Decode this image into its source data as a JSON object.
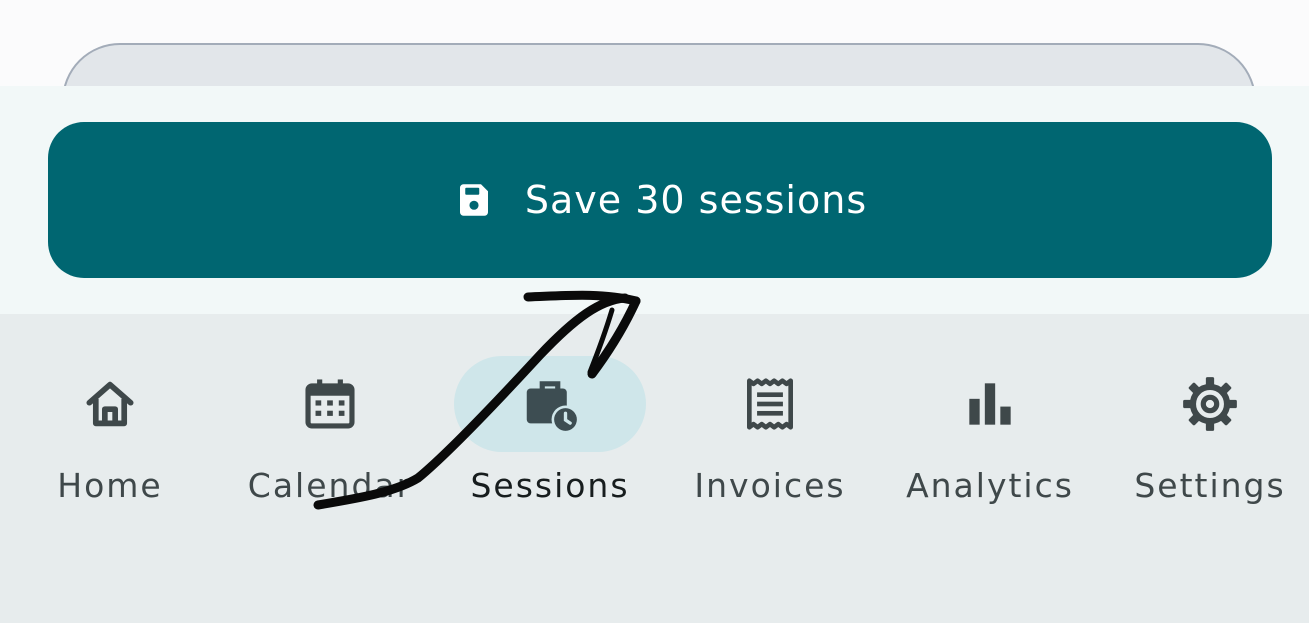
{
  "save_button": {
    "label": "Save 30 sessions",
    "icon": "floppy-disk-icon",
    "color": "#006671"
  },
  "nav": {
    "active_index": 2,
    "items": [
      {
        "label": "Home",
        "icon": "home-icon"
      },
      {
        "label": "Calendar",
        "icon": "calendar-icon"
      },
      {
        "label": "Sessions",
        "icon": "briefcase-clock-icon"
      },
      {
        "label": "Invoices",
        "icon": "receipt-icon"
      },
      {
        "label": "Analytics",
        "icon": "bar-chart-icon"
      },
      {
        "label": "Settings",
        "icon": "gear-icon"
      }
    ]
  },
  "colors": {
    "nav_background": "#e7eced",
    "active_pill": "#cfe6ea",
    "annotation_stroke": "#0a0a0a"
  }
}
